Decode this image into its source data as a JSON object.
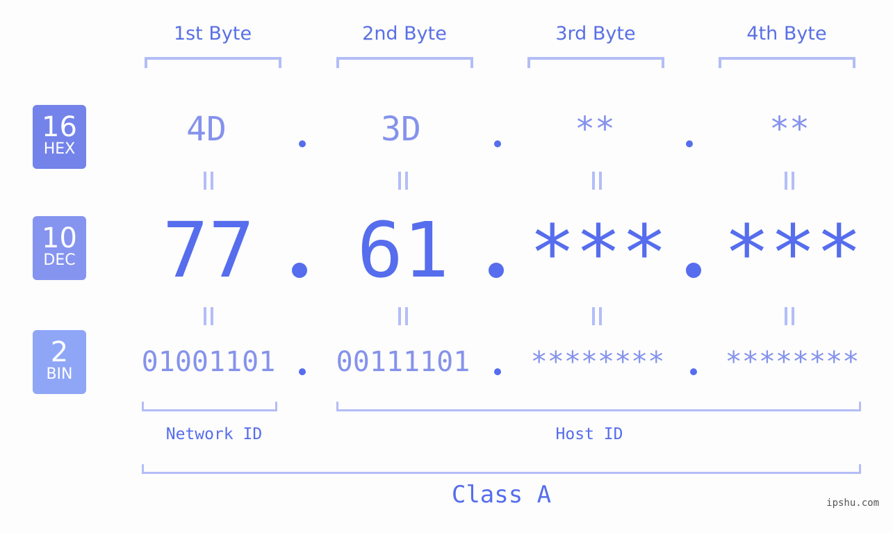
{
  "bytes": {
    "headers": [
      "1st Byte",
      "2nd Byte",
      "3rd Byte",
      "4th Byte"
    ]
  },
  "badges": {
    "hex": {
      "num": "16",
      "label": "HEX",
      "color": "#7383ea"
    },
    "dec": {
      "num": "10",
      "label": "DEC",
      "color": "#8594ef"
    },
    "bin": {
      "num": "2",
      "label": "BIN",
      "color": "#8fa6f6"
    }
  },
  "hex": [
    "4D",
    "3D",
    "**",
    "**"
  ],
  "dec": [
    "77",
    "61",
    "***",
    "***"
  ],
  "bin": [
    "01001101",
    "00111101",
    "********",
    "********"
  ],
  "separator": ".",
  "labels": {
    "network_id": "Network ID",
    "host_id": "Host ID",
    "class": "Class A"
  },
  "watermark": "ipshu.com",
  "colors": {
    "accent": "#566ded",
    "light": "#8592ec",
    "bracket": "#b3bdf7"
  }
}
